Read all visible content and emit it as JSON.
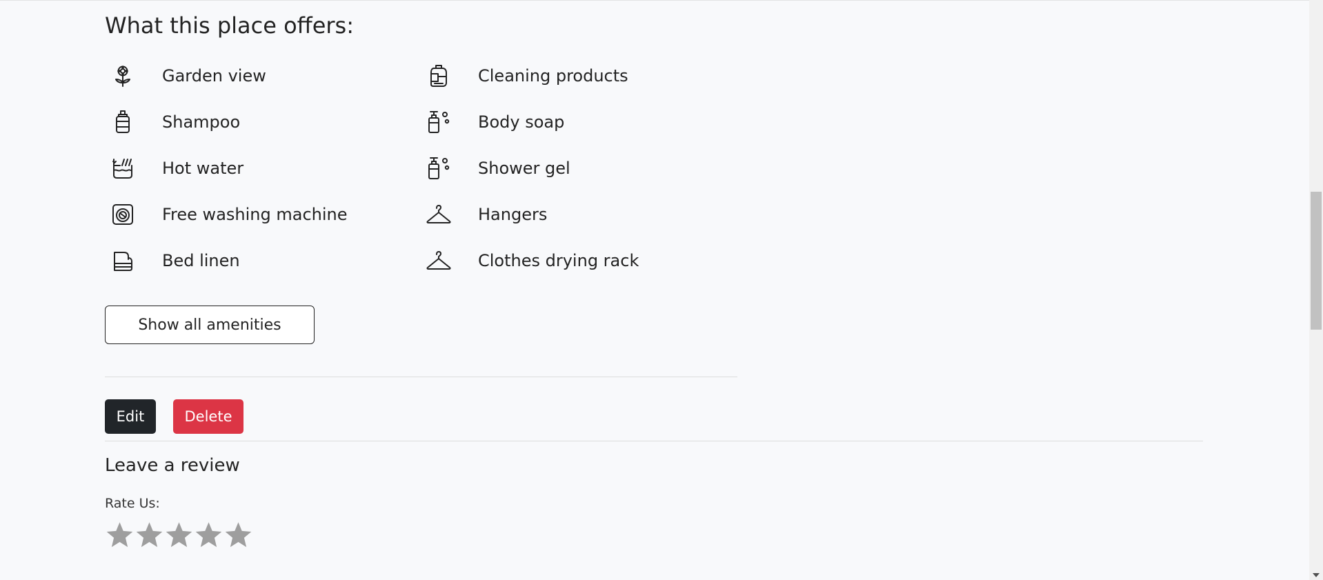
{
  "section_title": "What this place offers:",
  "amenities_left": [
    {
      "label": "Garden view",
      "icon": "flower-icon"
    },
    {
      "label": "Shampoo",
      "icon": "shampoo-bottle-icon"
    },
    {
      "label": "Hot water",
      "icon": "hot-water-icon"
    },
    {
      "label": "Free washing machine",
      "icon": "washing-machine-icon"
    },
    {
      "label": "Bed linen",
      "icon": "bed-linen-icon"
    }
  ],
  "amenities_right": [
    {
      "label": "Cleaning products",
      "icon": "cleaning-products-icon"
    },
    {
      "label": "Body soap",
      "icon": "soap-bottle-icon"
    },
    {
      "label": "Shower gel",
      "icon": "soap-bottle-icon"
    },
    {
      "label": "Hangers",
      "icon": "hanger-icon"
    },
    {
      "label": "Clothes drying rack",
      "icon": "hanger-icon"
    }
  ],
  "show_all_label": "Show all amenities",
  "actions": {
    "edit_label": "Edit",
    "delete_label": "Delete"
  },
  "review": {
    "title": "Leave a review",
    "rate_label": "Rate Us:",
    "rating": 0,
    "max_rating": 5
  },
  "colors": {
    "background": "#f8f9fb",
    "edit_button": "#212529",
    "delete_button": "#dc3545",
    "star_inactive": "#9e9e9e"
  }
}
